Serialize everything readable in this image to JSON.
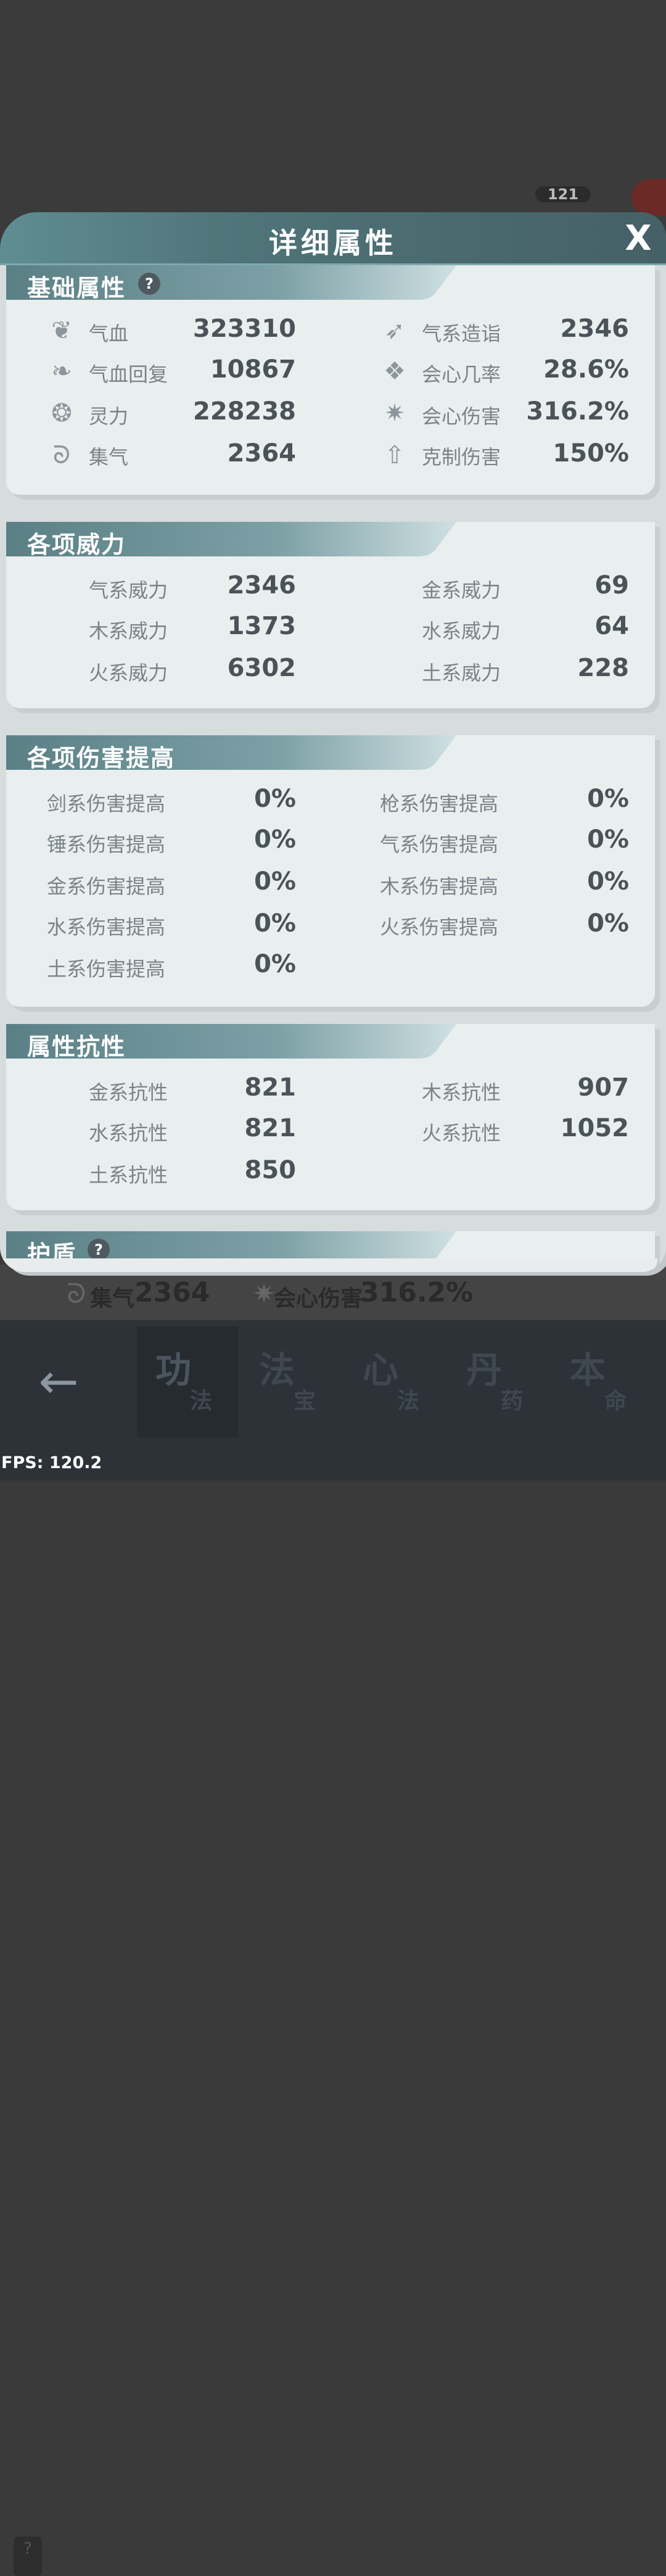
{
  "background": {
    "badge": "121",
    "strip": {
      "label1": "集气",
      "value1": "2364",
      "label2": "会心伤害",
      "value2": "316.2%"
    },
    "strip_icons": {
      "left": "swirl-icon",
      "right": "burst-icon"
    },
    "help_mark": "?"
  },
  "bottom_nav": {
    "back_icon": "←",
    "tabs": [
      {
        "big": "功",
        "small": "法"
      },
      {
        "big": "法",
        "small": "宝"
      },
      {
        "big": "心",
        "small": "法"
      },
      {
        "big": "丹",
        "small": "药"
      },
      {
        "big": "本",
        "small": "命"
      }
    ]
  },
  "fps": "FPS: 120.2",
  "dialog": {
    "title": "详细属性",
    "close": "X",
    "sections": {
      "basic": {
        "title": "基础属性",
        "help": "?",
        "left": [
          {
            "icon": "heart-icon",
            "label": "气血",
            "value": "323310"
          },
          {
            "icon": "heart-regen-icon",
            "label": "气血回复",
            "value": "10867"
          },
          {
            "icon": "spirit-drop-icon",
            "label": "灵力",
            "value": "228238"
          },
          {
            "icon": "swirl-icon",
            "label": "集气",
            "value": "2364"
          }
        ],
        "right": [
          {
            "icon": "qi-wing-icon",
            "label": "气系造诣",
            "value": "2346"
          },
          {
            "icon": "crit-rate-icon",
            "label": "会心几率",
            "value": "28.6%"
          },
          {
            "icon": "burst-icon",
            "label": "会心伤害",
            "value": "316.2%"
          },
          {
            "icon": "arrow-up-icon",
            "label": "克制伤害",
            "value": "150%"
          }
        ]
      },
      "power": {
        "title": "各项威力",
        "left": [
          {
            "label": "气系威力",
            "value": "2346"
          },
          {
            "label": "木系威力",
            "value": "1373"
          },
          {
            "label": "火系威力",
            "value": "6302"
          }
        ],
        "right": [
          {
            "label": "金系威力",
            "value": "69"
          },
          {
            "label": "水系威力",
            "value": "64"
          },
          {
            "label": "土系威力",
            "value": "228"
          }
        ]
      },
      "damage": {
        "title": "各项伤害提高",
        "left": [
          {
            "label": "剑系伤害提高",
            "value": "0%"
          },
          {
            "label": "锤系伤害提高",
            "value": "0%"
          },
          {
            "label": "金系伤害提高",
            "value": "0%"
          },
          {
            "label": "水系伤害提高",
            "value": "0%"
          },
          {
            "label": "土系伤害提高",
            "value": "0%"
          }
        ],
        "right": [
          {
            "label": "枪系伤害提高",
            "value": "0%"
          },
          {
            "label": "气系伤害提高",
            "value": "0%"
          },
          {
            "label": "木系伤害提高",
            "value": "0%"
          },
          {
            "label": "火系伤害提高",
            "value": "0%"
          }
        ]
      },
      "resist": {
        "title": "属性抗性",
        "left": [
          {
            "label": "金系抗性",
            "value": "821"
          },
          {
            "label": "水系抗性",
            "value": "821"
          },
          {
            "label": "土系抗性",
            "value": "850"
          }
        ],
        "right": [
          {
            "label": "木系抗性",
            "value": "907"
          },
          {
            "label": "火系抗性",
            "value": "1052"
          }
        ]
      },
      "shield": {
        "title": "护盾",
        "help": "?"
      }
    }
  }
}
